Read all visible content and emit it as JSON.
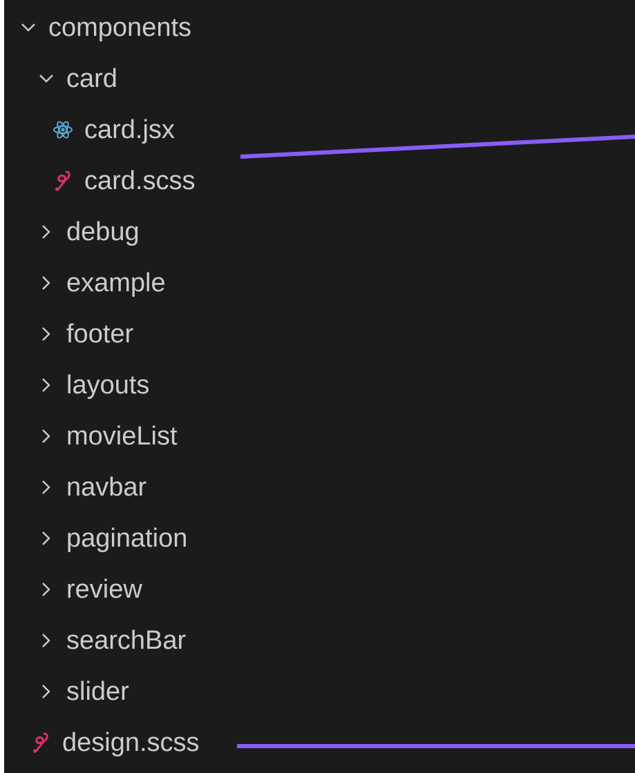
{
  "explorer": {
    "root": {
      "label": "components",
      "expanded": true,
      "icon": "chevron-down-icon"
    },
    "card_folder": {
      "label": "card",
      "expanded": true,
      "icon": "chevron-down-icon"
    },
    "card_files": [
      {
        "label": "card.jsx",
        "icon": "react-icon",
        "icon_color": "#5ba7d1"
      },
      {
        "label": "card.scss",
        "icon": "sass-icon",
        "icon_color": "#d6336c"
      }
    ],
    "folders": [
      {
        "label": "debug"
      },
      {
        "label": "example"
      },
      {
        "label": "footer"
      },
      {
        "label": "layouts"
      },
      {
        "label": "movieList"
      },
      {
        "label": "navbar"
      },
      {
        "label": "pagination"
      },
      {
        "label": "review"
      },
      {
        "label": "searchBar"
      },
      {
        "label": "slider"
      }
    ],
    "root_files": [
      {
        "label": "design.scss",
        "icon": "sass-icon",
        "icon_color": "#d6336c"
      }
    ]
  },
  "colors": {
    "background": "#1b1b1c",
    "text": "#cccccc",
    "annotation_line": "#8a5cf6"
  }
}
